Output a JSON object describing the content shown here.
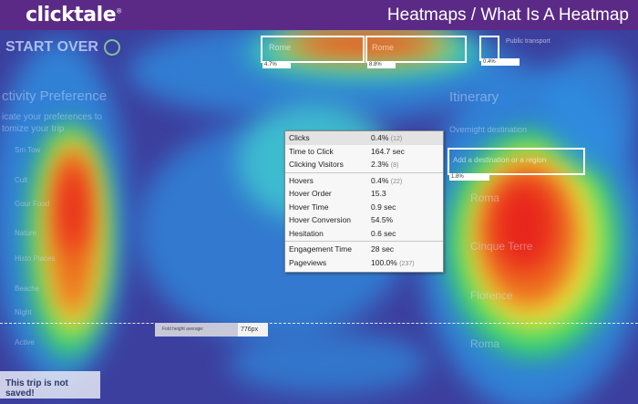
{
  "header": {
    "logo": "clicktale",
    "logo_mark": "®",
    "title": "Heatmaps / What Is A Heatmap"
  },
  "page": {
    "start_over": "START OVER",
    "activity_preferences": "ctivity Preference",
    "pref_sub1": "icate your preferences to",
    "pref_sub2": "tomize your trip",
    "itinerary": "Itinerary",
    "overnight": "Overnight destination",
    "add_destination": "Add a destination or a region",
    "not_saved": "This trip is not saved!",
    "destinations": [
      "Roma",
      "Cinque Terre",
      "Florence",
      "Roma"
    ],
    "left_items": [
      "Sm Tow",
      "Cult",
      "Gour Food",
      "Nature",
      "Histo Places",
      "Beache",
      "Night",
      "Active"
    ]
  },
  "highlights": [
    {
      "text": "Rome",
      "pct": "4.7%"
    },
    {
      "text": "Rome",
      "pct": "8.8%"
    },
    {
      "text": "Public transport",
      "pct": "0.4%"
    },
    {
      "text": "",
      "pct": "1.8%"
    }
  ],
  "fold": {
    "label": "Fold height average:",
    "value": "776px"
  },
  "stats": [
    {
      "label": "Clicks",
      "value": "0.4%",
      "count": "(12)",
      "hdr": true
    },
    {
      "label": "Time to Click",
      "value": "164.7 sec"
    },
    {
      "label": "Clicking Visitors",
      "value": "2.3%",
      "count": "(8)"
    },
    {
      "sep": true
    },
    {
      "label": "Hovers",
      "value": "0.4%",
      "count": "(22)"
    },
    {
      "label": "Hover Order",
      "value": "15.3"
    },
    {
      "label": "Hover Time",
      "value": "0.9 sec"
    },
    {
      "label": "Hover Conversion",
      "value": "54.5%"
    },
    {
      "label": "Hesitation",
      "value": "0.6 sec"
    },
    {
      "sep": true
    },
    {
      "label": "Engagement Time",
      "value": "28 sec"
    },
    {
      "label": "Pageviews",
      "value": "100.0%",
      "count": "(237)"
    }
  ],
  "colors": {
    "header_bg": "#5b2a86",
    "heat_cold": "#3c3f9e",
    "heat_hot": "#e8261c"
  }
}
